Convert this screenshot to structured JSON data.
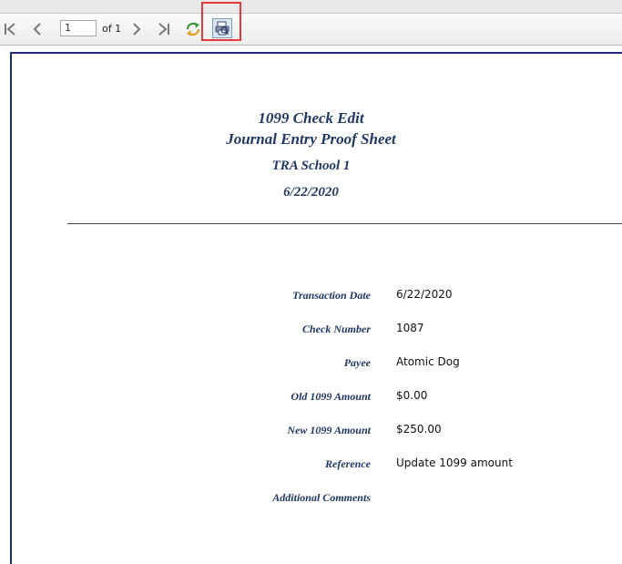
{
  "toolbar": {
    "page_value": "1",
    "page_of_label": "of 1",
    "icons": {
      "first": "first-page-icon",
      "prev": "previous-page-icon",
      "next": "next-page-icon",
      "last": "last-page-icon",
      "refresh": "refresh-icon",
      "print": "print-icon"
    },
    "highlight_color": "#e8393f"
  },
  "report": {
    "title1": "1099 Check Edit",
    "title2": "Journal Entry Proof Sheet",
    "school": "TRA School 1",
    "date": "6/22/2020",
    "title_color": "#1f3864",
    "fields": [
      {
        "label": "Transaction Date",
        "value": "6/22/2020"
      },
      {
        "label": "Check Number",
        "value": "1087"
      },
      {
        "label": "Payee",
        "value": "Atomic Dog"
      },
      {
        "label": "Old 1099 Amount",
        "value": "$0.00"
      },
      {
        "label": "New 1099 Amount",
        "value": "$250.00"
      },
      {
        "label": "Reference",
        "value": "Update 1099 amount"
      },
      {
        "label": "Additional Comments",
        "value": ""
      }
    ]
  }
}
